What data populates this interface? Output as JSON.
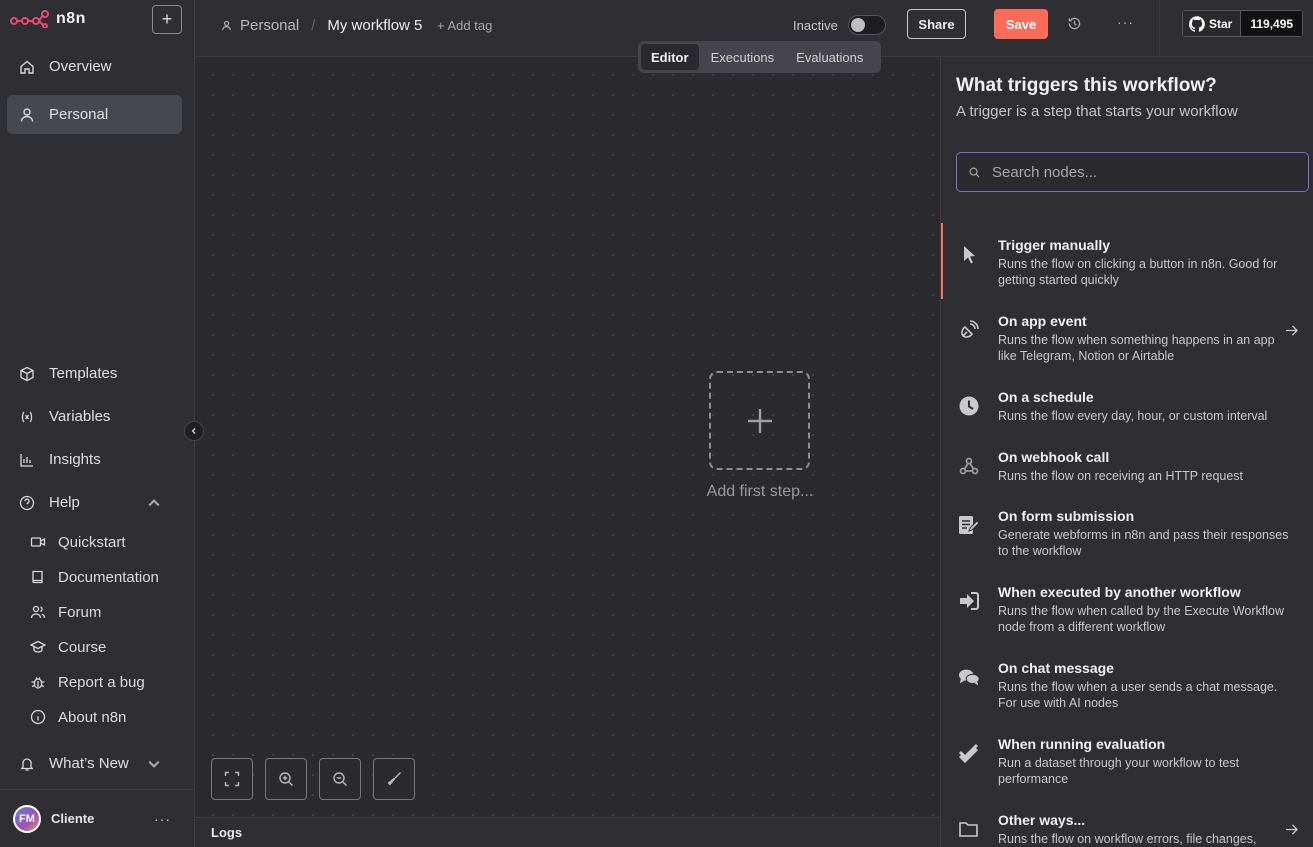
{
  "app": {
    "name": "n8n"
  },
  "sidebar": {
    "new_button": "+",
    "top_items": [
      {
        "label": "Overview",
        "icon": "home-icon"
      },
      {
        "label": "Personal",
        "icon": "user-icon",
        "active": true
      }
    ],
    "bottom_items": [
      {
        "label": "Templates",
        "icon": "box-icon"
      },
      {
        "label": "Variables",
        "icon": "variable-icon"
      },
      {
        "label": "Insights",
        "icon": "chart-icon"
      },
      {
        "label": "Help",
        "icon": "help-icon"
      }
    ],
    "help_items": [
      {
        "label": "Quickstart",
        "icon": "video-icon"
      },
      {
        "label": "Documentation",
        "icon": "book-icon"
      },
      {
        "label": "Forum",
        "icon": "users-icon"
      },
      {
        "label": "Course",
        "icon": "graduation-icon"
      },
      {
        "label": "Report a bug",
        "icon": "bug-icon"
      },
      {
        "label": "About n8n",
        "icon": "info-icon"
      }
    ],
    "whats_new": "What’s New",
    "user": {
      "initials": "FM",
      "name": "Cliente",
      "more": "···"
    }
  },
  "header": {
    "breadcrumb_project": "Personal",
    "breadcrumb_separator": "/",
    "workflow_name": "My workflow 5",
    "add_tag": "+ Add tag",
    "status_label": "Inactive",
    "active": false,
    "share_label": "Share",
    "save_label": "Save",
    "more": "···",
    "github": {
      "star_label": "Star",
      "count": "119,495"
    }
  },
  "tabs": [
    {
      "label": "Editor",
      "active": true
    },
    {
      "label": "Executions"
    },
    {
      "label": "Evaluations"
    }
  ],
  "canvas": {
    "add_first_step": "Add first step...",
    "logs_label": "Logs"
  },
  "panel": {
    "title": "What triggers this workflow?",
    "subtitle": "A trigger is a step that starts your workflow",
    "search_placeholder": "Search nodes...",
    "nodes": [
      {
        "title": "Trigger manually",
        "desc": "Runs the flow on clicking a button in n8n. Good for getting started quickly",
        "icon": "cursor-icon",
        "active": true
      },
      {
        "title": "On app event",
        "desc": "Runs the flow when something happens in an app like Telegram, Notion or Airtable",
        "icon": "satellite-icon",
        "arrow": true
      },
      {
        "title": "On a schedule",
        "desc": "Runs the flow every day, hour, or custom interval",
        "icon": "clock-icon"
      },
      {
        "title": "On webhook call",
        "desc": "Runs the flow on receiving an HTTP request",
        "icon": "webhook-icon"
      },
      {
        "title": "On form submission",
        "desc": "Generate webforms in n8n and pass their responses to the workflow",
        "icon": "form-icon"
      },
      {
        "title": "When executed by another workflow",
        "desc": "Runs the flow when called by the Execute Workflow node from a different workflow",
        "icon": "sign-in-icon"
      },
      {
        "title": "On chat message",
        "desc": "Runs the flow when a user sends a chat message. For use with AI nodes",
        "icon": "chat-icon"
      },
      {
        "title": "When running evaluation",
        "desc": "Run a dataset through your workflow to test performance",
        "icon": "check-double-icon"
      },
      {
        "title": "Other ways...",
        "desc": "Runs the flow on workflow errors, file changes,",
        "icon": "folder-icon",
        "arrow": true
      }
    ]
  },
  "colors": {
    "accent": "#ff6d5a",
    "search_border": "#7f6ed6",
    "background": "#2e2e33",
    "canvas": "#2a2a2f"
  }
}
